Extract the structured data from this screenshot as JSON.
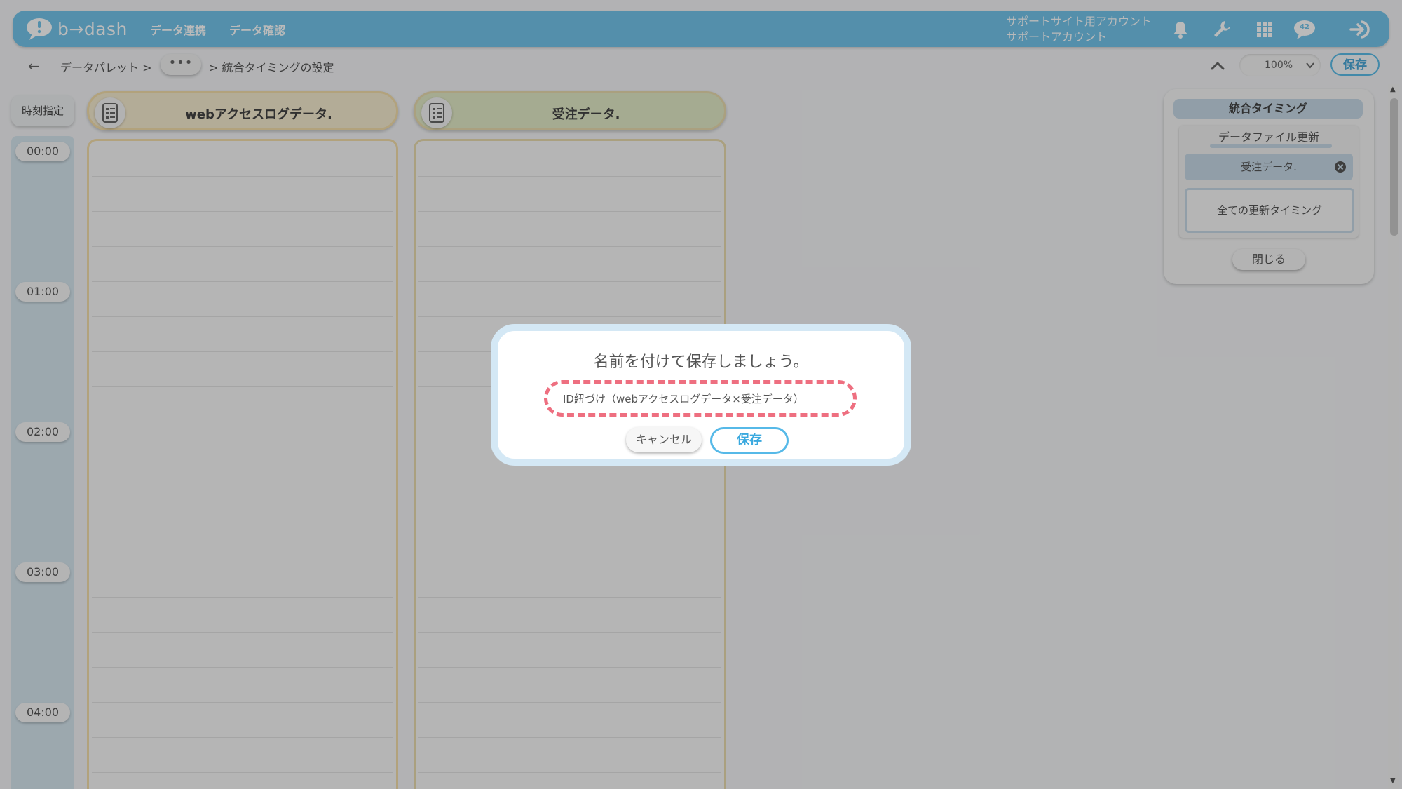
{
  "header": {
    "logo_text": "b→dash",
    "nav": [
      "データ連携",
      "データ確認"
    ],
    "account_line1": "サポートサイト用アカウント",
    "account_line2": "サポートアカウント",
    "notification_badge": "42"
  },
  "toolbar": {
    "back": "←",
    "breadcrumb_root": "データパレット >",
    "ellipsis": "•••",
    "breadcrumb_current": "> 統合タイミングの設定",
    "zoom": "100%",
    "save_label": "保存"
  },
  "timeline": {
    "header": "時刻指定",
    "times": [
      "00:00",
      "01:00",
      "02:00",
      "03:00",
      "04:00"
    ]
  },
  "lanes": [
    {
      "title": "webアクセスログデータ.",
      "color": "#f6ecd0",
      "border": "#f5deaa"
    },
    {
      "title": "受注データ.",
      "color": "#e3ebc7",
      "border": "#e9dcaf"
    }
  ],
  "right_panel": {
    "title": "統合タイミング",
    "subtitle": "データファイル更新",
    "file": "受注データ.",
    "all_timings": "全ての更新タイミング",
    "close_label": "閉じる"
  },
  "modal": {
    "title": "名前を付けて保存しましょう。",
    "name_value": "ID紐づけ（webアクセスログデータ×受注データ）",
    "cancel_label": "キャンセル",
    "save_label": "保存"
  },
  "colors": {
    "header_bg": "#73c5eb",
    "accent": "#56b9e8",
    "input_highlight": "#ee6f80"
  }
}
